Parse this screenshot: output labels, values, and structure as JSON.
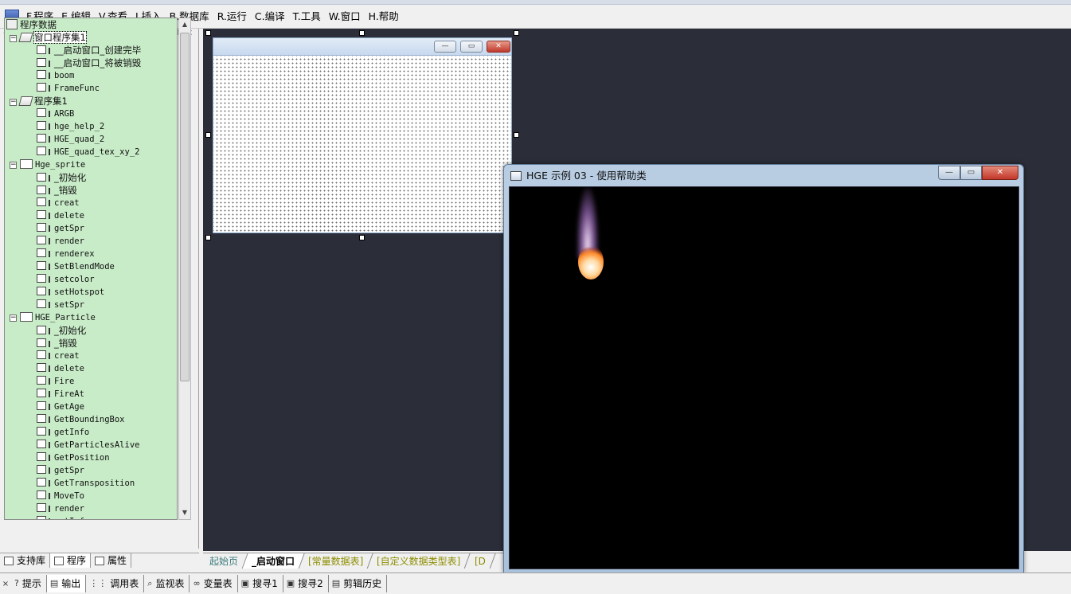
{
  "menu": {
    "items": [
      "F.程序",
      "E.编辑",
      "V.查看",
      "I.插入",
      "B.数据库",
      "R.运行",
      "C.编译",
      "T.工具",
      "W.窗口",
      "H.帮助"
    ]
  },
  "left_panel": {
    "pin": "◘",
    "close": "×",
    "tree": {
      "root": "程序数据",
      "groups": [
        {
          "label": "窗口程序集1",
          "type": "window-assembly",
          "selected": true,
          "items": [
            "__启动窗口_创建完毕",
            "__启动窗口_将被销毁",
            "boom",
            "FrameFunc"
          ]
        },
        {
          "label": "程序集1",
          "type": "assembly",
          "items": [
            "ARGB",
            "hge_help_2",
            "HGE_quad_2",
            "HGE_quad_tex_xy_2"
          ]
        },
        {
          "label": "Hge_sprite",
          "type": "class",
          "items": [
            "_初始化",
            "_销毁",
            "creat",
            "delete",
            "getSpr",
            "render",
            "renderex",
            "SetBlendMode",
            "setcolor",
            "setHotspot",
            "setSpr"
          ]
        },
        {
          "label": "HGE_Particle",
          "type": "class",
          "items": [
            "_初始化",
            "_销毁",
            "creat",
            "delete",
            "Fire",
            "FireAt",
            "GetAge",
            "GetBoundingBox",
            "getInfo",
            "GetParticlesAlive",
            "GetPosition",
            "getSpr",
            "GetTransposition",
            "MoveTo",
            "render",
            "setInfo"
          ]
        }
      ]
    },
    "tabs": [
      {
        "label": "支持库",
        "active": false
      },
      {
        "label": "程序",
        "active": true
      },
      {
        "label": "属性",
        "active": false
      }
    ]
  },
  "designer_tabs": [
    {
      "label": "起始页",
      "active": false,
      "style": "teal"
    },
    {
      "label": "_启动窗口",
      "active": true,
      "style": "teal"
    },
    {
      "label": "[常量数据表]",
      "active": false,
      "style": "yellow"
    },
    {
      "label": "[自定义数据类型表]",
      "active": false,
      "style": "yellow"
    },
    {
      "label": "[D",
      "active": false,
      "style": "yellow"
    }
  ],
  "form_buttons": {
    "min": "—",
    "max": "▭",
    "close": "✕"
  },
  "hge_window": {
    "title": "HGE 示例 03 - 使用帮助类",
    "min": "—",
    "max": "▭",
    "close": "✕"
  },
  "bottom_tabs": [
    {
      "label": "提示",
      "icon": "?",
      "active": false
    },
    {
      "label": "输出",
      "icon": "▤",
      "active": true
    },
    {
      "label": "调用表",
      "icon": "⋮⋮",
      "active": false
    },
    {
      "label": "监视表",
      "icon": "⌕",
      "active": false
    },
    {
      "label": "变量表",
      "icon": "∞",
      "active": false
    },
    {
      "label": "搜寻1",
      "icon": "▣",
      "active": false
    },
    {
      "label": "搜寻2",
      "icon": "▣",
      "active": false
    },
    {
      "label": "剪辑历史",
      "icon": "▤",
      "active": false
    }
  ],
  "bottom_close": "×"
}
